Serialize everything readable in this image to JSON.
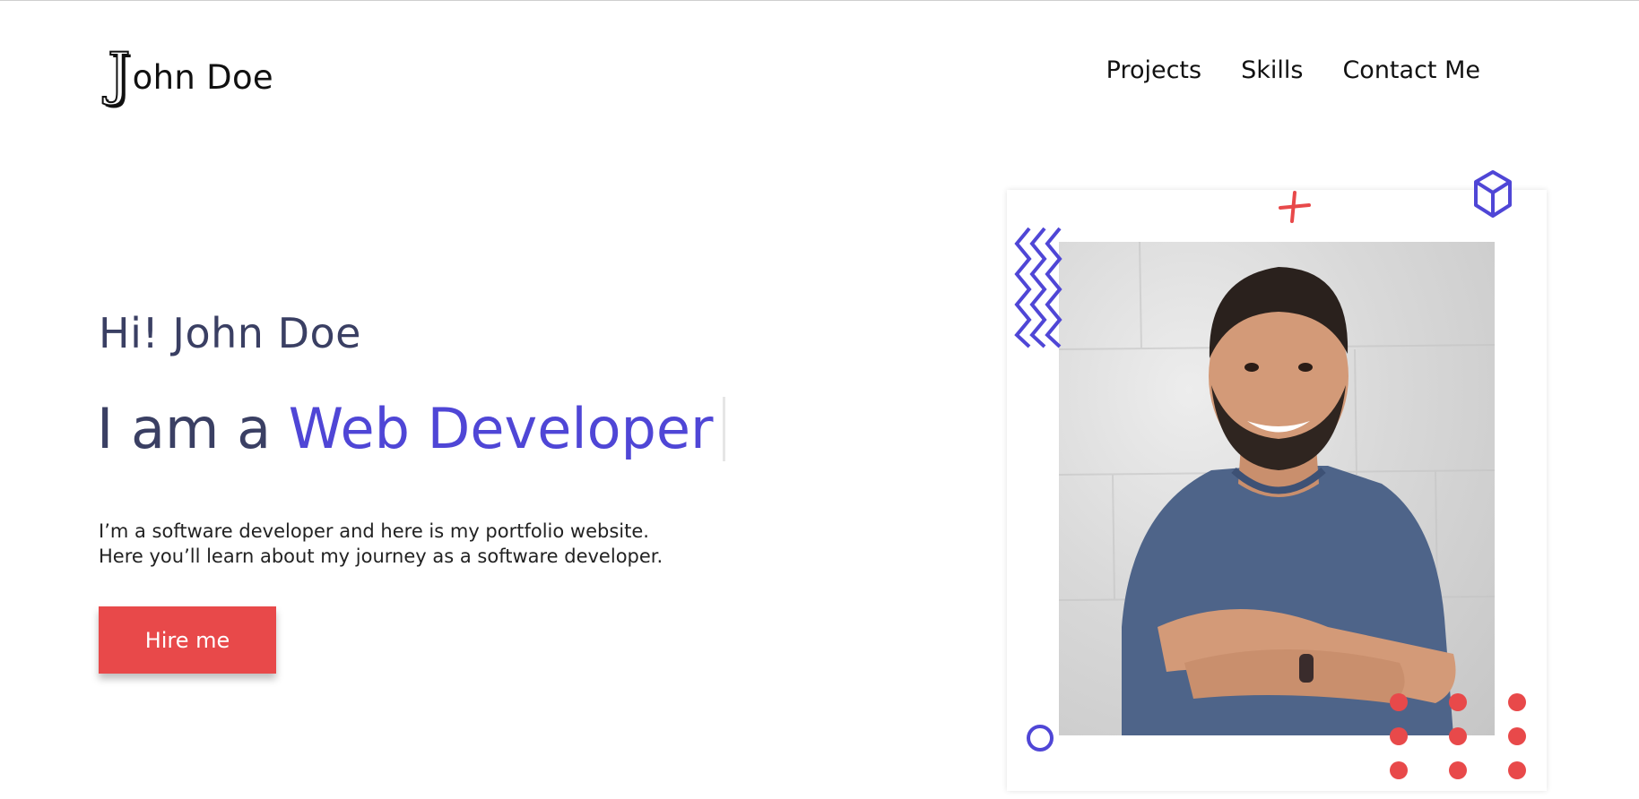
{
  "header": {
    "logo_initial": "J",
    "logo_rest": "ohn Doe",
    "nav": [
      {
        "label": "Projects"
      },
      {
        "label": "Skills"
      },
      {
        "label": "Contact Me"
      }
    ]
  },
  "hero": {
    "greeting": "Hi! John Doe",
    "role_prefix": "I am a ",
    "role_highlight": "Web Developer",
    "description_line1": "I’m a software developer and here is my portfolio website.",
    "description_line2": "Here you’ll learn about my journey as a software developer.",
    "cta_label": "Hire me"
  },
  "colors": {
    "accent_purple": "#4f46d6",
    "accent_red": "#e8494a",
    "heading_text": "#3a3f63"
  },
  "icons": {
    "zigzag": "zigzag-decoration",
    "plus": "plus-decoration",
    "cube": "cube-outline",
    "circle": "circle-outline",
    "dots": "dot-grid"
  }
}
